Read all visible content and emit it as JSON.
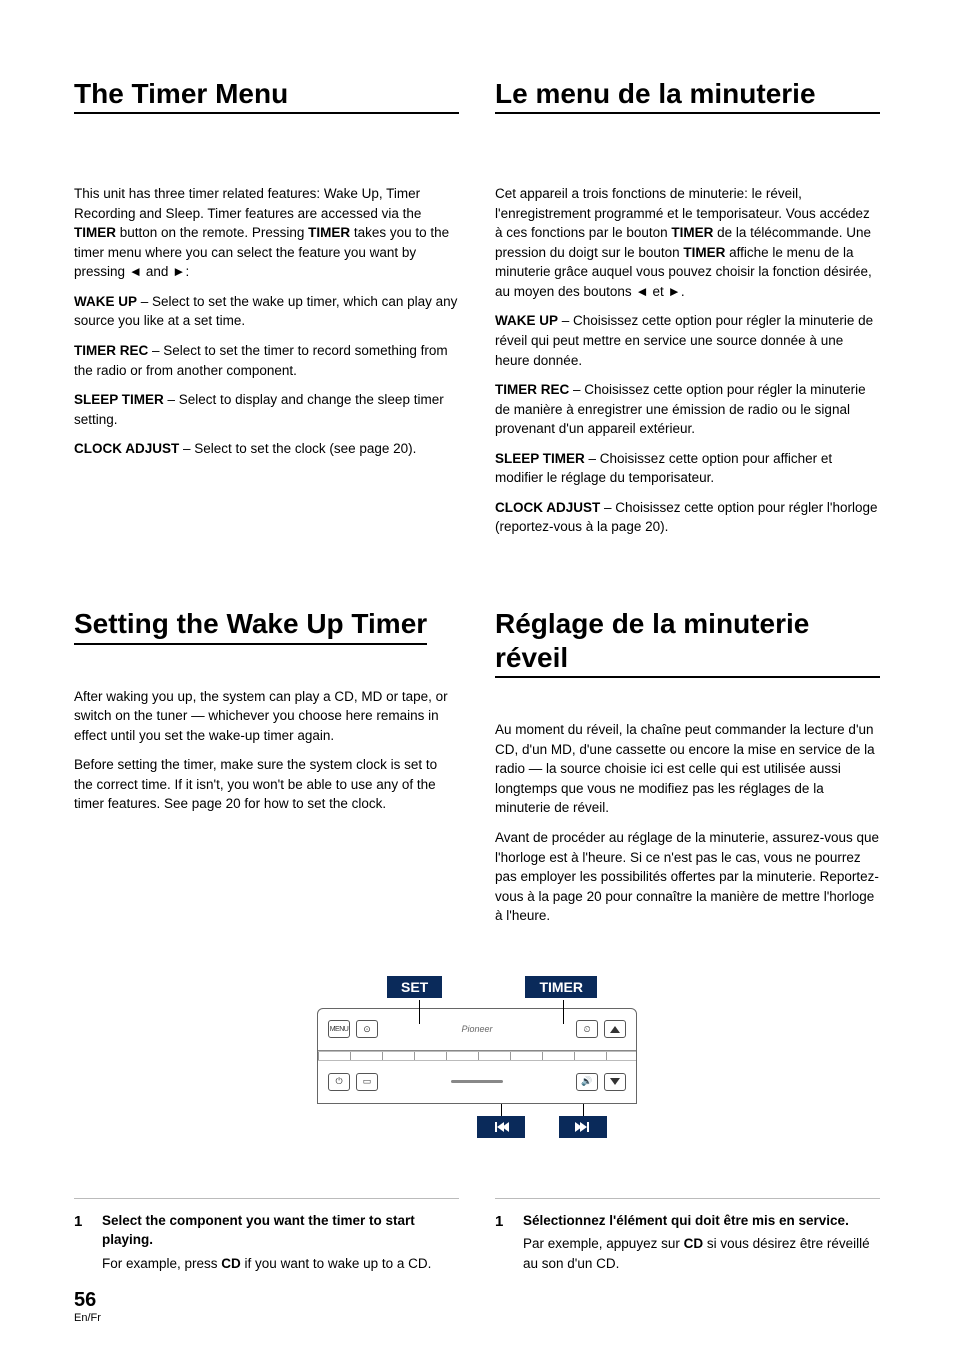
{
  "header": {
    "left_title": "The Timer Menu",
    "right_title": "Le menu de la minuterie"
  },
  "intro": {
    "en": "This unit has three timer related features: Wake Up, Timer Recording and Sleep. Timer features are accessed via the TIMER button on the remote. Pressing TIMER takes you to the timer menu where you can select the feature you want by pressing \u0019 and \u001a:",
    "fr": "Cet appareil a trois fonctions de minuterie: le réveil, l'enregistrement programmé et le temporisateur. Vous accédez à ces fonctions par le bouton TIMER de la télécommande. Une pression du doigt sur le bouton TIMER affiche le menu de la minuterie grâce auquel vous pouvez choisir la fonction désirée, au moyen des boutons \u0019 et \u001a."
  },
  "defs": {
    "en": [
      {
        "term": "WAKE UP",
        "def": " – Select to set the wake up timer, which can play any source you like at a set time."
      },
      {
        "term": "TIMER REC",
        "def": " – Select to set the timer to record something from the radio or from another component."
      },
      {
        "term": "SLEEP TIMER",
        "def": " – Select to display and change the sleep timer setting."
      },
      {
        "term": "CLOCK ADJUST",
        "def": " – Select to set the clock (see page 20)."
      }
    ],
    "fr": [
      {
        "term": "WAKE UP",
        "def": " – Choisissez cette option pour régler la minuterie de réveil qui peut mettre en service une source donnée à une heure donnée."
      },
      {
        "term": "TIMER REC",
        "def": " – Choisissez cette option pour régler la minuterie de manière à enregistrer une émission de radio ou le signal provenant d'un appareil extérieur."
      },
      {
        "term": "SLEEP TIMER",
        "def": " – Choisissez cette option pour afficher et modifier le réglage du temporisateur."
      },
      {
        "term": "CLOCK ADJUST",
        "def": " – Choisissez cette option pour régler l'horloge (reportez-vous à la page 20)."
      }
    ]
  },
  "setting": {
    "en_title": "Setting the Wake Up Timer",
    "fr_title": "Réglage de la minuterie réveil",
    "en_para1": "After waking you up, the system can play a CD, MD or tape, or switch on the tuner — whichever you choose here remains in effect until you set the wake-up timer again.",
    "en_para2": "Before setting the timer, make sure the system clock is set to the correct time. If it isn't, you won't be able to use any of the timer features. See page 20 for how to set the clock.",
    "fr_para1": "Au moment du réveil, la chaîne peut commander la lecture d'un CD, d'un MD, d'une cassette ou encore la mise en service de la radio — la source choisie ici est celle qui est utilisée aussi longtemps que vous ne modifiez pas les réglages de la minuterie de réveil.",
    "fr_para2": "Avant de procéder au réglage de la minuterie, assurez-vous que l'horloge est à l'heure. Si ce n'est pas le cas, vous ne pourrez pas employer les possibilités offertes par la minuterie. Reportez-vous à la page 20 pour connaître la manière de mettre l'horloge à l'heure."
  },
  "remote": {
    "set_label": "SET",
    "timer_label": "TIMER",
    "menu_btn": "MENU",
    "pioneer": "Pioneer"
  },
  "steps": {
    "en": {
      "num": "1",
      "lead": "Select the component you want the timer to start playing.",
      "sub": "For example, press CD if you want to wake up to a CD."
    },
    "fr": {
      "num": "1",
      "lead": "Sélectionnez l'élément qui doit être mis en service.",
      "sub": "Par exemple, appuyez sur CD si vous désirez être réveillé au son d'un CD."
    }
  },
  "footer": {
    "page": "56",
    "lang": "En/Fr"
  }
}
